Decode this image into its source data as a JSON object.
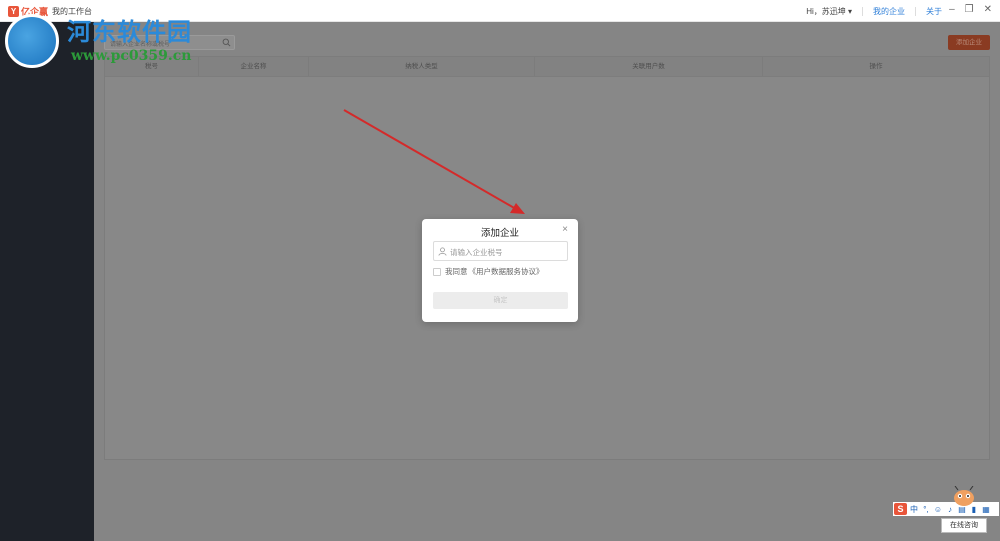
{
  "app": {
    "logo_text": "亿企赢",
    "title": "我的工作台"
  },
  "header": {
    "greeting": "Hi，苏迅坤",
    "my_company": "我的企业",
    "about": "关于"
  },
  "toolbar": {
    "search_placeholder": "请输入企业名称或税号",
    "add_button": "添加企业"
  },
  "table": {
    "columns": [
      "税号",
      "企业名称",
      "纳税人类型",
      "关联用户数",
      "操作"
    ]
  },
  "dialog": {
    "title": "添加企业",
    "close": "×",
    "tax_placeholder": "请输入企业税号",
    "agree_text": "我同意",
    "agreement_link": "《用户数据服务协议》",
    "confirm_button": "确定"
  },
  "watermark": {
    "title": "河东软件园",
    "url": "www.pc0359.cn"
  },
  "ime": {
    "logo": "S",
    "mode": "中"
  },
  "consult_button": "在线咨询",
  "colors": {
    "accent": "#e8553a",
    "link": "#2f7fd8",
    "sidebar": "#1e2229",
    "arrow": "#d42a2a"
  }
}
